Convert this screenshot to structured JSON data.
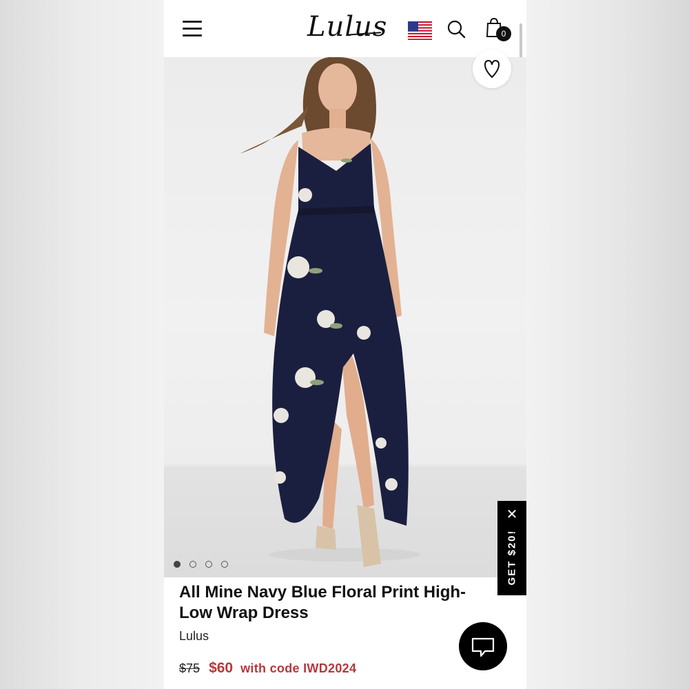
{
  "header": {
    "logo": "Lulus",
    "cart_count": "0"
  },
  "icons": {
    "menu": "hamburger-menu-icon",
    "flag": "us-flag-icon",
    "search": "search-icon",
    "cart": "shopping-bag-icon",
    "wishlist": "heart-icon",
    "chat": "chat-bubble-icon",
    "close": "close-icon"
  },
  "carousel": {
    "slides": 4,
    "active_index": 0
  },
  "promo": {
    "label": "GET $20!",
    "close": "✕"
  },
  "product": {
    "title": "All Mine Navy Blue Floral Print High-Low Wrap Dress",
    "brand": "Lulus",
    "original_price": "$75",
    "sale_price": "$60",
    "code_text": "with code IWD2024"
  },
  "colors": {
    "accent_sale": "#b5383a",
    "dress_navy": "#1b1f3f"
  }
}
